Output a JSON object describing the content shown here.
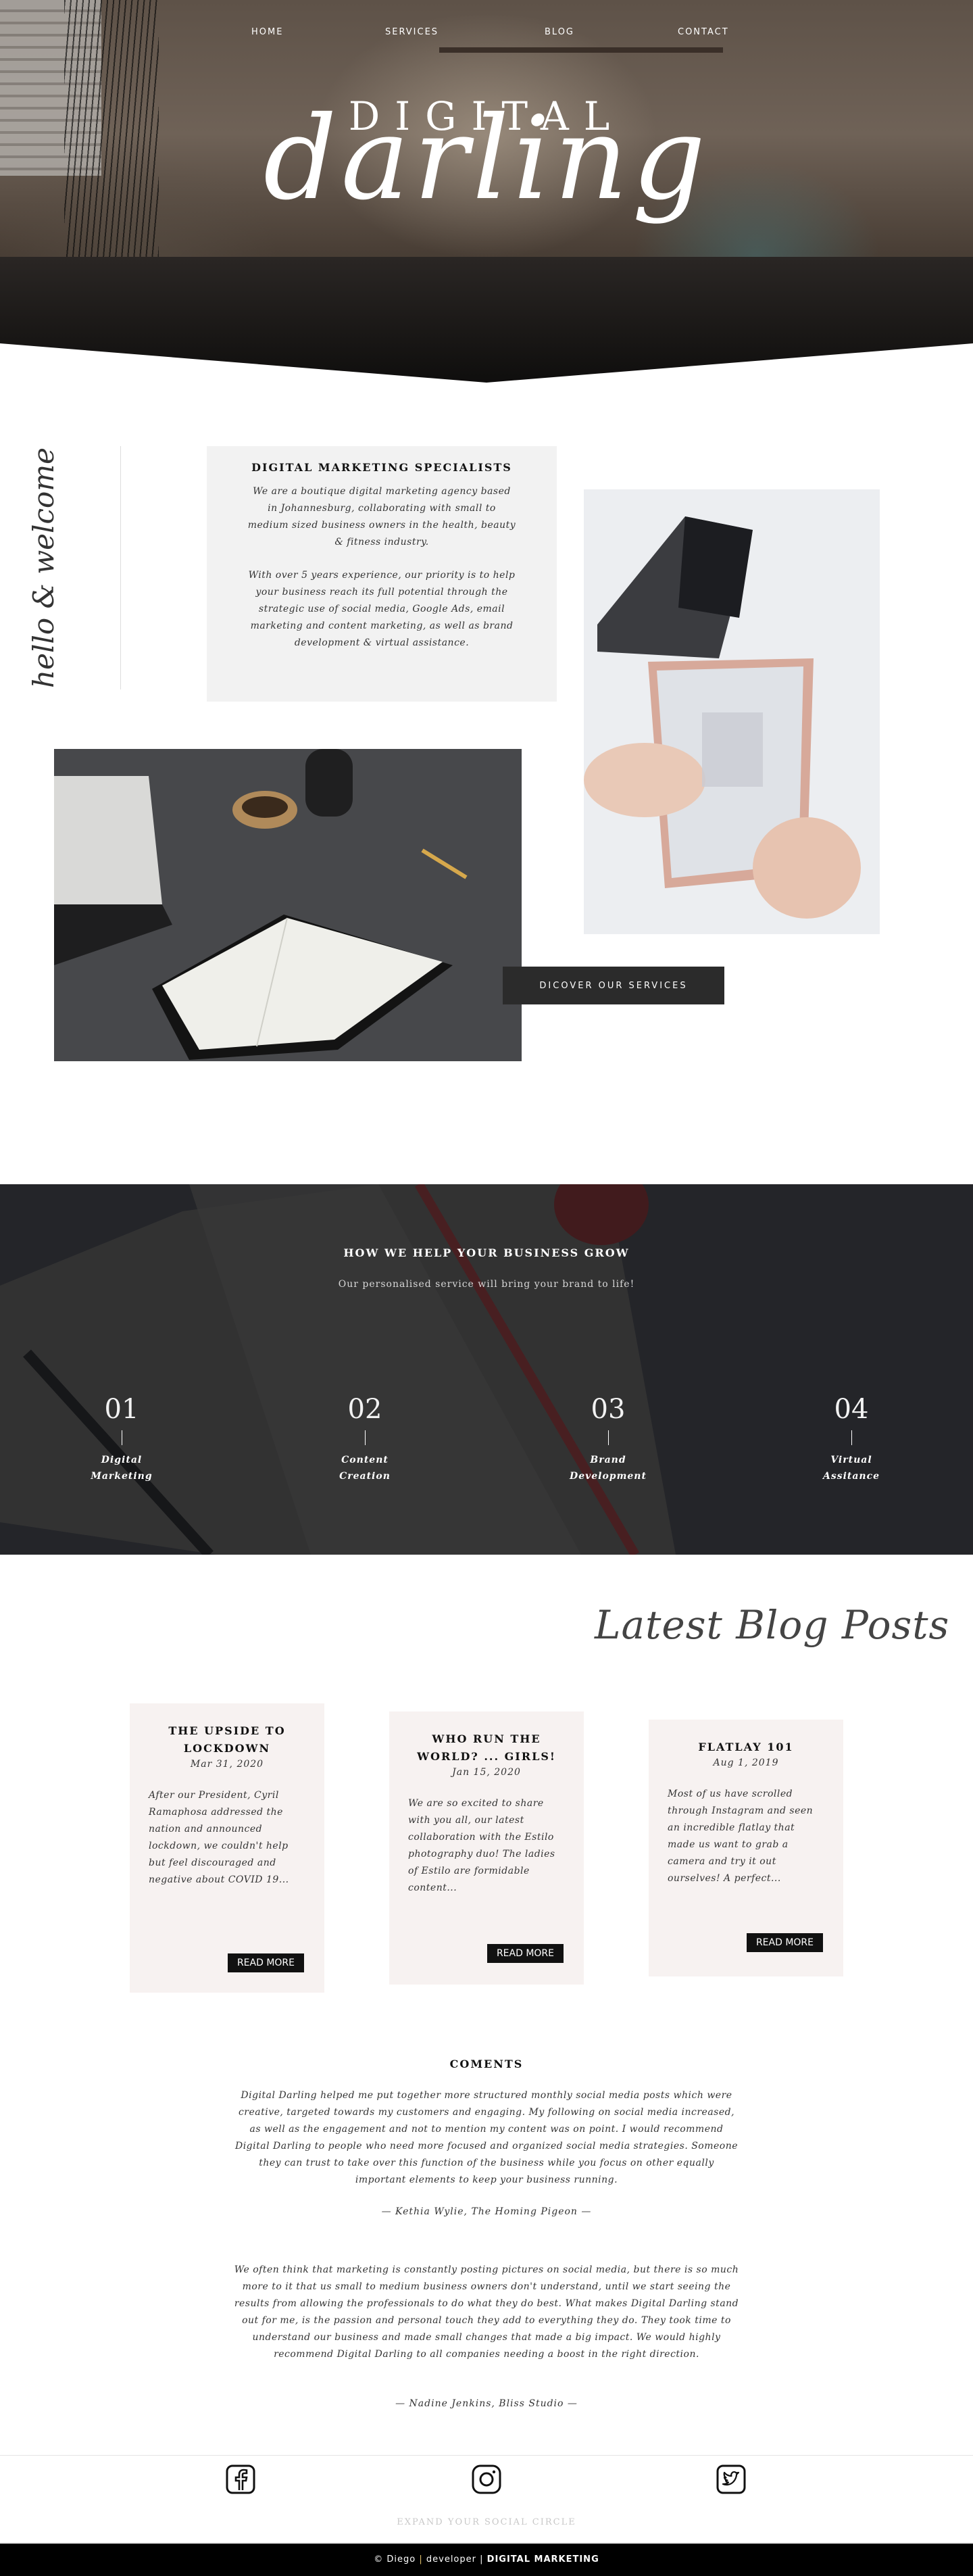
{
  "nav": {
    "items": [
      "HOME",
      "SERVICES",
      "BLOG",
      "CONTACT"
    ]
  },
  "brand": {
    "top": "DIGITAL",
    "script": "darling"
  },
  "about": {
    "vertical_text": "hello & welcome",
    "title": "DIGITAL MARKETING SPECIALISTS",
    "p1": "We are a boutique digital marketing agency based in Johannesburg, collaborating with small to medium sized business owners in the health, beauty & fitness industry.",
    "p2": "With over 5 years experience, our priority is to help your business reach its full potential through the strategic use of social media, Google Ads, email marketing and content marketing, as well as brand development & virtual assistance.",
    "button": "DICOVER OUR SERVICES"
  },
  "services": {
    "title": "HOW WE HELP YOUR BUSINESS GROW",
    "subtitle": "Our personalised service will bring your brand to life!",
    "items": [
      {
        "num": "01",
        "label": "Digital\nMarketing"
      },
      {
        "num": "02",
        "label": "Content\nCreation"
      },
      {
        "num": "03",
        "label": "Brand\nDevelopment"
      },
      {
        "num": "04",
        "label": "Virtual\nAssitance"
      }
    ]
  },
  "blog": {
    "heading": "Latest Blog Posts",
    "posts": [
      {
        "title": "THE UPSIDE TO LOCKDOWN",
        "date": "Mar 31, 2020",
        "excerpt": "After our President, Cyril Ramaphosa addressed the nation and announced lockdown, we couldn't help but feel discouraged and negative about COVID 19...",
        "button": "READ MORE"
      },
      {
        "title": "WHO RUN THE WORLD? ... GIRLS!",
        "date": "Jan 15, 2020",
        "excerpt": "We are so excited to share with you all, our latest collaboration with the Estilo photography duo! The ladies of Estilo are formidable content...",
        "button": "READ MORE"
      },
      {
        "title": "FLATLAY 101",
        "date": "Aug 1, 2019",
        "excerpt": "Most of us have scrolled through Instagram and seen an incredible flatlay that made us want to grab a camera and try it out ourselves! A perfect...",
        "button": "READ MORE"
      }
    ]
  },
  "comments": {
    "title": "COMENTS",
    "items": [
      {
        "text": "Digital Darling helped me put together more structured monthly social media posts which were creative, targeted towards my customers and engaging. My following on social media increased, as well as the engagement and not to mention my content was on point. I would recommend Digital Darling to people who need more focused and organized social media strategies. Someone they can trust to take over this function of the business while you focus on other equally important elements to keep your business running.",
        "author": "— Kethia Wylie, The Homing Pigeon —"
      },
      {
        "text": "We often think that marketing is constantly posting pictures on social media, but there is so much more to it that us small to medium business owners don't understand, until we start seeing the results from allowing the professionals to do what they do best. What makes Digital Darling stand out for me, is the passion and personal touch they add to everything they do. They took time to understand our business and made small changes that made a big impact. We would highly recommend Digital Darling to all companies needing a boost in the right direction.",
        "author": "— Nadine Jenkins, Bliss Studio —"
      }
    ]
  },
  "social": {
    "icons": [
      "facebook-icon",
      "instagram-icon",
      "twitter-icon"
    ],
    "label": "EXPAND YOUR SOCIAL CIRCLE"
  },
  "footer": {
    "left": "© Diego",
    "sep": "|",
    "mid": "developer",
    "sep2": "|",
    "right": "DIGITAL MARKETING"
  }
}
